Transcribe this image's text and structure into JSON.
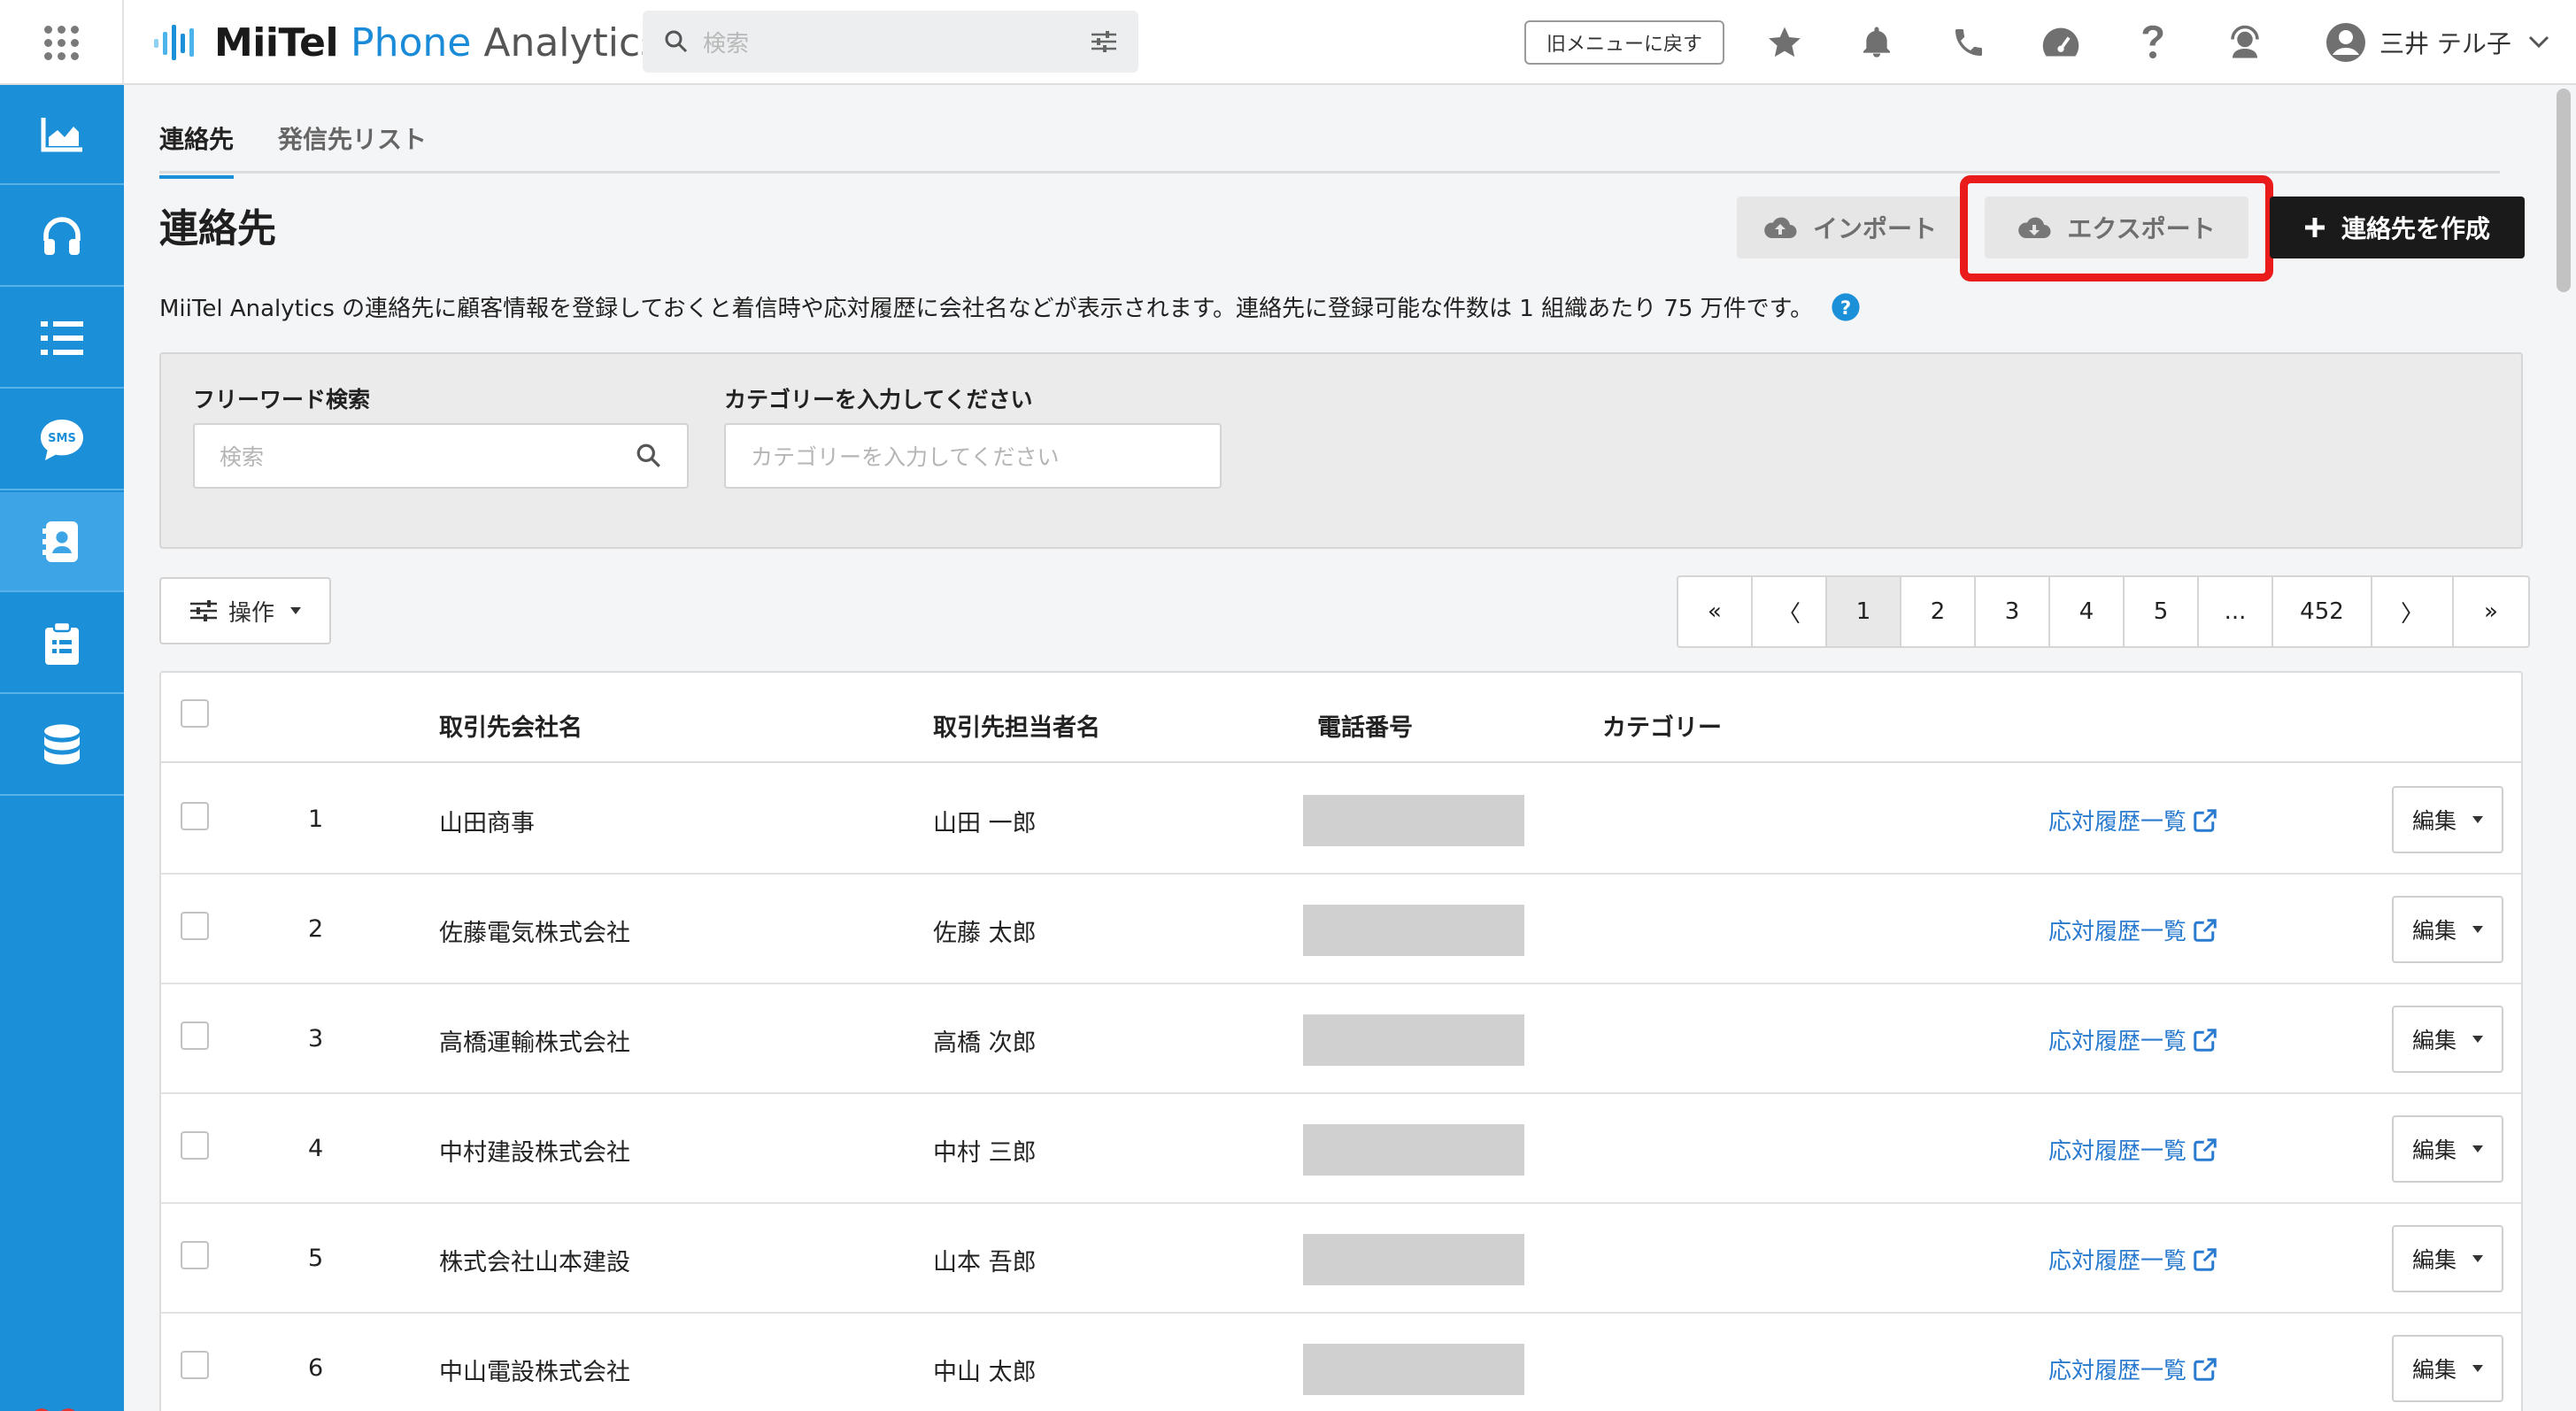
{
  "header": {
    "brand": {
      "name": "MiiTel",
      "phone": "Phone",
      "analytics": "Analytics"
    },
    "search_placeholder": "検索",
    "old_menu_label": "旧メニューに戻す",
    "user_name": "三井 テル子"
  },
  "sidebar": {
    "items": [
      {
        "icon": "analytics-chart-icon"
      },
      {
        "icon": "headset-icon"
      },
      {
        "icon": "list-icon"
      },
      {
        "icon": "sms-icon"
      },
      {
        "icon": "contacts-icon",
        "active": true
      },
      {
        "icon": "clipboard-icon"
      },
      {
        "icon": "database-icon"
      }
    ],
    "sms_text": "SMS"
  },
  "tabs": [
    "連絡先",
    "発信先リスト"
  ],
  "page_title": "連絡先",
  "actions": {
    "import_label": "インポート",
    "export_label": "エクスポート",
    "create_label": "連絡先を作成"
  },
  "description": "MiiTel Analytics の連絡先に顧客情報を登録しておくと着信時や応対履歴に会社名などが表示されます。連絡先に登録可能な件数は 1 組織あたり 75 万件です。",
  "filters": {
    "freeword_label": "フリーワード検索",
    "freeword_placeholder": "検索",
    "category_label": "カテゴリーを入力してください",
    "category_placeholder": "カテゴリーを入力してください"
  },
  "operations_label": "操作",
  "pagination": [
    "«",
    "〈",
    "1",
    "2",
    "3",
    "4",
    "5",
    "...",
    "452",
    "〉",
    "»"
  ],
  "pagination_active": "1",
  "table": {
    "columns": [
      "取引先会社名",
      "取引先担当者名",
      "電話番号",
      "カテゴリー"
    ],
    "history_link_label": "応対履歴一覧",
    "edit_label": "編集",
    "rows": [
      {
        "no": "1",
        "company": "山田商事",
        "contact": "山田 一郎"
      },
      {
        "no": "2",
        "company": "佐藤電気株式会社",
        "contact": "佐藤 太郎"
      },
      {
        "no": "3",
        "company": "高橋運輸株式会社",
        "contact": "高橋 次郎"
      },
      {
        "no": "4",
        "company": "中村建設株式会社",
        "contact": "中村 三郎"
      },
      {
        "no": "5",
        "company": "株式会社山本建設",
        "contact": "山本 吾郎"
      },
      {
        "no": "6",
        "company": "中山電設株式会社",
        "contact": "中山 太郎"
      }
    ]
  },
  "colors": {
    "sidebar": "#1b8fd8",
    "link": "#2a7bcf",
    "highlight": "#ea1b1b",
    "primary_button": "#1a1a1a"
  }
}
